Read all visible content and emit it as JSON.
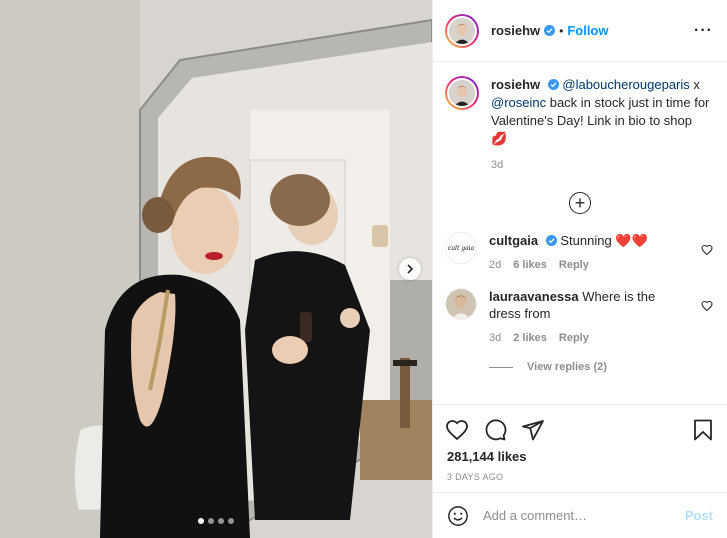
{
  "post": {
    "username": "rosiehw",
    "follow_label": "Follow",
    "separator": "•",
    "more_label": "···"
  },
  "caption": {
    "username": "rosiehw",
    "mention_1": "@laboucherougeparis",
    "text_1": " x ",
    "mention_2": "@roseinc",
    "text_2": " back in stock just in time for Valentine's Day! Link in bio to shop 💋",
    "age": "3d"
  },
  "comments": [
    {
      "username": "cultgaia",
      "avatar_text": "cult gaia",
      "text": "Stunning ❤️❤️",
      "age": "2d",
      "likes": "6 likes",
      "reply_label": "Reply"
    },
    {
      "username": "lauraavanessa",
      "text": "Where is the dress from",
      "age": "3d",
      "likes": "2 likes",
      "reply_label": "Reply",
      "view_replies": "View replies (2)"
    }
  ],
  "load_more_symbol": "+",
  "stats": {
    "likes": "281,144 likes",
    "time_ago": "3 DAYS AGO"
  },
  "composer": {
    "placeholder": "Add a comment…",
    "post_label": "Post"
  },
  "carousel": {
    "slide_count": 4,
    "active_index": 0
  },
  "colors": {
    "accent": "#0095f6",
    "text": "#262626",
    "secondary": "#8e8e8e",
    "post_disabled": "#b2dffc"
  },
  "icons": [
    "verified-badge-icon",
    "more-options-icon",
    "plus-circle-icon",
    "heart-icon",
    "comment-icon",
    "share-icon",
    "bookmark-icon",
    "emoji-icon",
    "chevron-right-icon"
  ]
}
